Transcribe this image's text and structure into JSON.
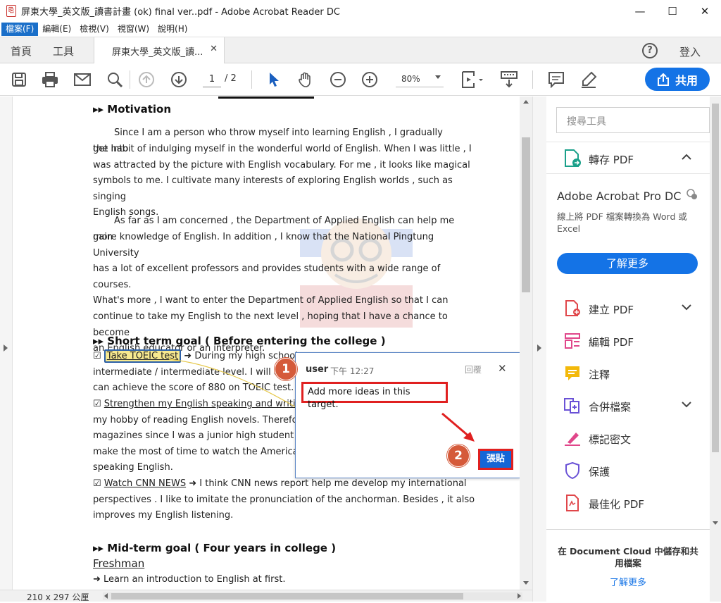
{
  "window": {
    "title": "屏東大學_英文版_讀書計畫 (ok) final ver..pdf - Adobe Acrobat Reader DC"
  },
  "menu": [
    "檔案(F)",
    "編輯(E)",
    "檢視(V)",
    "視窗(W)",
    "說明(H)"
  ],
  "tabs": {
    "home": "首頁",
    "tools": "工具",
    "doc": "屏東大學_英文版_讀...",
    "signin": "登入"
  },
  "toolbar": {
    "page_current": "1",
    "page_total": "/ 2",
    "zoom": "80%",
    "share": "共用"
  },
  "document": {
    "motivation_heading": "▸▸  Motivation",
    "p1": [
      "Since I am a person who throw myself into learning English , I gradually get into",
      "the habit of indulging myself in the wonderful world of English. When I was little , I",
      "was attracted by the picture with English vocabulary. For me , it looks like magical",
      "symbols to me. I cultivate many interests of exploring English worlds , such as singing",
      "English songs."
    ],
    "p2": [
      "As far as I am concerned , the Department of Applied English can help me gain",
      "more knowledge of English. In addition , I know that the National Pingtung University",
      "has a lot of excellent professors and provides students with a wide range of courses.",
      "What's more , I want to enter the Department of Applied English so that I can",
      "continue to take my English to the next level , hoping that I have a chance to become",
      "an English educator or an interpreter."
    ],
    "short_heading": "▸▸  Short term goal ( Before entering the college )",
    "goal1_check": "☑",
    "goal1_title": "Take TOEIC test",
    "goal1_rest": "➜ During my high school yea",
    "goal1_l2": "intermediate / intermediate level. I will atte",
    "goal1_l3": "can achieve the score of 880 on TOEIC test.",
    "goal2_check": "☑",
    "goal2_title": "Strengthen my English speaking and writing sk",
    "goal2_l2": "my hobby of reading English novels. Therefore ,",
    "goal2_l3": "magazines since I was a junior high student , suc",
    "goal2_l4": "make the most of time to watch the American s",
    "goal2_l5": "speaking English.",
    "goal3_check": "☑",
    "goal3_title": "Watch CNN NEWS",
    "goal3_rest": "➜ I think CNN news report help me develop my international",
    "goal3_l2": "perspectives . I like to imitate the pronunciation of the anchorman. Besides , it also",
    "goal3_l3": "improves my English listening.",
    "mid_heading": "▸▸  Mid-term goal ( Four years in college )",
    "freshman": "Freshman",
    "fresh_l1": "➜ Learn an introduction to English at first."
  },
  "comment": {
    "user": "user",
    "time": "下午 12:27",
    "reply": "回覆",
    "text": "Add more ideas in this target.",
    "paste": "張貼",
    "badge1": "1",
    "badge2": "2"
  },
  "status": {
    "dims": "210 x 297 公厘"
  },
  "rightpane": {
    "search_placeholder": "搜尋工具",
    "export_label": "轉存 PDF",
    "product": "Adobe Acrobat Pro DC",
    "desc": "線上將 PDF 檔案轉換為 Word 或 Excel",
    "learn_more_btn": "了解更多",
    "tools": [
      "建立 PDF",
      "編輯 PDF",
      "注釋",
      "合併檔案",
      "標記密文",
      "保護",
      "最佳化 PDF"
    ],
    "cloud_text": "在 Document Cloud 中儲存和共用檔案",
    "cloud_link": "了解更多"
  },
  "colors": {
    "accent": "#1473e6",
    "annotation_red": "#e02020",
    "badge": "#d55a3a",
    "highlight": "#f7e98f"
  }
}
